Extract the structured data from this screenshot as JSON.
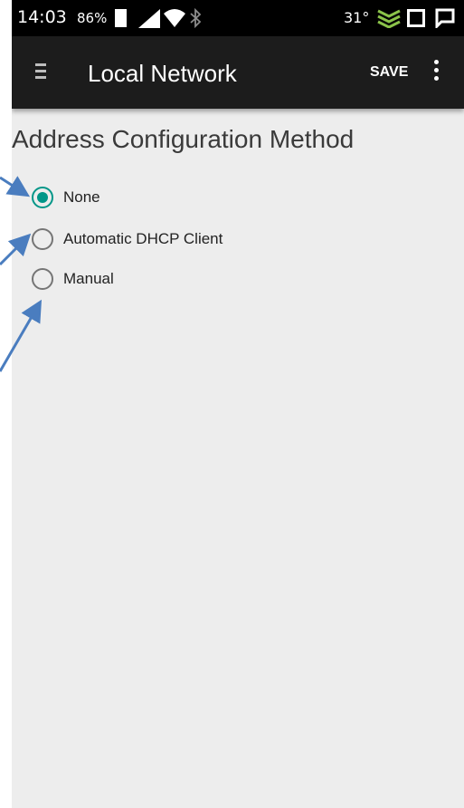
{
  "status_bar": {
    "time": "14:03",
    "battery_percent": "86%",
    "temperature": "31°",
    "icons": [
      "battery-icon",
      "signal-icon",
      "wifi-icon",
      "bluetooth-icon",
      "leaf-icon",
      "square-icon",
      "chat-icon"
    ]
  },
  "app_bar": {
    "title": "Local Network",
    "save_label": "SAVE"
  },
  "main": {
    "heading": "Address Configuration Method",
    "options": [
      {
        "label": "None",
        "checked": true
      },
      {
        "label": "Automatic DHCP Client",
        "checked": false
      },
      {
        "label": "Manual",
        "checked": false
      }
    ]
  },
  "colors": {
    "accent": "#009688",
    "app_bar": "#1c1c1c",
    "background": "#ededed",
    "annotation_arrow": "#4a7dbf"
  }
}
